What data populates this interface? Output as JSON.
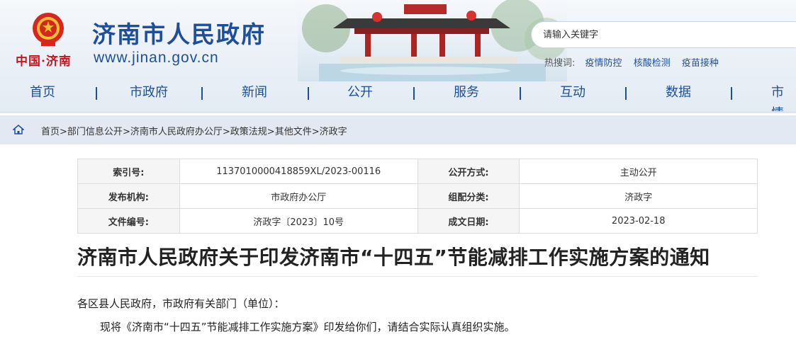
{
  "header": {
    "logo_text": "中国·济南",
    "site_title": "济南市人民政府",
    "site_url": "www.jinan.gov.cn",
    "search_placeholder": "请输入关键字",
    "hot_label": "热搜词:",
    "hot_links": [
      "疫情防控",
      "核酸检测",
      "疫苗接种"
    ],
    "nav": [
      "首页",
      "市政府",
      "新闻",
      "公开",
      "服务",
      "互动",
      "数据",
      "市情"
    ]
  },
  "breadcrumb": {
    "items": [
      "首页",
      "部门信息公开",
      "济南市人民政府办公厅",
      "政策法规",
      "其他文件",
      "济政字"
    ],
    "separator": ">"
  },
  "info": {
    "rows": [
      {
        "k1": "索引号:",
        "v1": "113701000041885 9XL/2023-00116",
        "k2": "公开方式:",
        "v2": "主动公开"
      },
      {
        "k1": "发布机构:",
        "v1": "市政府办公厅",
        "k2": "组配分类:",
        "v2": "济政字"
      },
      {
        "k1": "文件编号:",
        "v1": "济政字〔2023〕10号",
        "k2": "成文日期:",
        "v2": "2023-02-18"
      }
    ]
  },
  "document": {
    "title": "济南市人民政府关于印发济南市“十四五”节能减排工作实施方案的通知",
    "salutation": "各区县人民政府，市政府有关部门（单位）：",
    "body": "现将《济南市“十四五”节能减排工作实施方案》印发给你们，请结合实际认真组织实施。"
  },
  "colors": {
    "brand": "#1e4f9a",
    "accent_red": "#c8161d",
    "crumb_bg": "#e3e9f2"
  }
}
